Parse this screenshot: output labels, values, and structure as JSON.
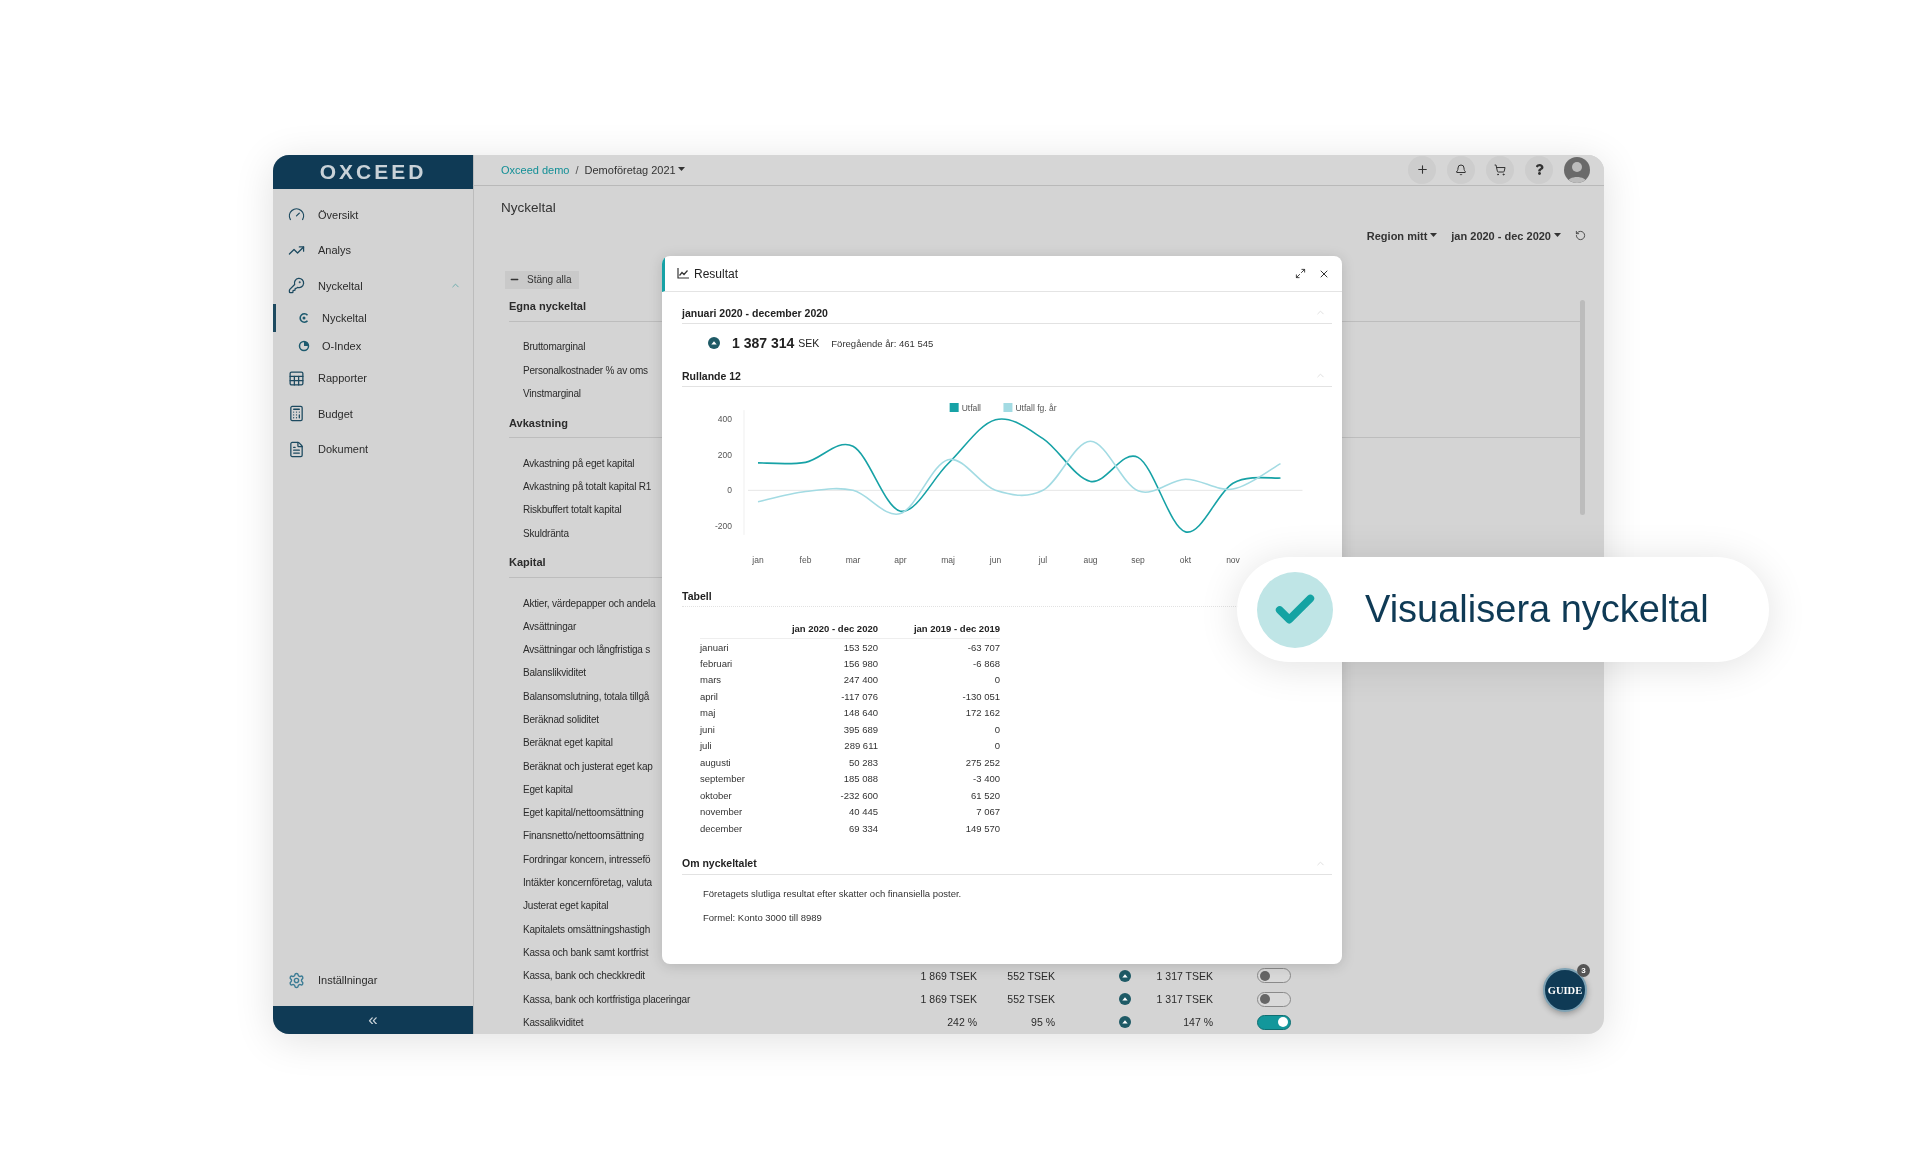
{
  "sidebar": {
    "logo": "OXCEED",
    "items": [
      {
        "label": "Översikt",
        "selected": false
      },
      {
        "label": "Analys",
        "selected": false
      },
      {
        "label": "Nyckeltal",
        "selected": false,
        "expanded": true,
        "children": [
          {
            "label": "Nyckeltal",
            "selected": true
          },
          {
            "label": "O-Index",
            "selected": false
          }
        ]
      },
      {
        "label": "Rapporter",
        "selected": false
      },
      {
        "label": "Budget",
        "selected": false
      },
      {
        "label": "Dokument",
        "selected": false
      }
    ],
    "settings": "Inställningar",
    "collapse": "«"
  },
  "topbar": {
    "breadcrumb": [
      {
        "kind": "link",
        "label": "Oxceed demo"
      },
      {
        "kind": "dropdown",
        "label": "Demoföretag 2021"
      }
    ],
    "separator": "/"
  },
  "page": {
    "title": "Nyckeltal",
    "filters": [
      {
        "label": "Region mitt"
      },
      {
        "label": "jan 2020 - dec 2020"
      }
    ],
    "collapse_all": "Stäng alla",
    "sections": [
      {
        "title": "Egna nyckeltal",
        "items": [
          {
            "label": "Bruttomarginal"
          },
          {
            "label": "Personalkostnader % av oms"
          },
          {
            "label": "Vinstmarginal"
          }
        ]
      },
      {
        "title": "Avkastning",
        "items": [
          {
            "label": "Avkastning på eget kapital"
          },
          {
            "label": "Avkastning på totalt kapital R1"
          },
          {
            "label": "Riskbuffert totalt kapital"
          },
          {
            "label": "Skuldränta"
          }
        ]
      },
      {
        "title": "Kapital",
        "items": [
          {
            "label": "Aktier, värdepapper och andela"
          },
          {
            "label": "Avsättningar"
          },
          {
            "label": "Avsättningar och långfristiga s"
          },
          {
            "label": "Balanslikviditet"
          },
          {
            "label": "Balansomslutning, totala tillgå"
          },
          {
            "label": "Beräknad soliditet"
          },
          {
            "label": "Beräknat eget kapital"
          },
          {
            "label": "Beräknat och justerat eget kap"
          },
          {
            "label": "Eget kapital"
          },
          {
            "label": "Eget kapital/nettoomsättning"
          },
          {
            "label": "Finansnetto/nettoomsättning"
          },
          {
            "label": "Fordringar koncern, intressefö"
          },
          {
            "label": "Intäkter koncernföretag, valuta"
          },
          {
            "label": "Justerat eget kapital"
          },
          {
            "label": "Kapitalets omsättningshastigh"
          },
          {
            "label": "Kassa och bank samt kortfrist"
          },
          {
            "label": "Kassa, bank och checkkredit",
            "values": {
              "current": "1 869 TSEK",
              "previous": "552 TSEK",
              "change": "1 317 TSEK",
              "on": false
            }
          },
          {
            "label": "Kassa, bank och kortfristiga placeringar",
            "values": {
              "current": "1 869 TSEK",
              "previous": "552 TSEK",
              "change": "1 317 TSEK",
              "on": false
            }
          },
          {
            "label": "Kassalikviditet",
            "values": {
              "current": "242 %",
              "previous": "95 %",
              "change": "147 %",
              "on": true
            }
          }
        ]
      }
    ]
  },
  "modal": {
    "title": "Resultat",
    "period": {
      "title": "januari 2020 - december 2020",
      "value": "1 387 314",
      "unit": "SEK",
      "previous": "Föregående år: 461 545"
    },
    "rolling": {
      "title": "Rullande 12",
      "chart_data": {
        "type": "line",
        "categories": [
          "jan",
          "feb",
          "mar",
          "apr",
          "maj",
          "jun",
          "jul",
          "aug",
          "sep",
          "okt",
          "nov",
          null
        ],
        "yticks": [
          -200,
          0,
          200,
          400
        ],
        "ylim": [
          -250,
          450
        ],
        "legend": "top",
        "series": [
          {
            "name": "Utfall",
            "color": "#17a2a6",
            "values": [
              154,
              157,
              247,
              -117,
              149,
              396,
              290,
              50,
              185,
              -233,
              40,
              69
            ]
          },
          {
            "name": "Utfall fg. år",
            "color": "#a3dbe3",
            "values": [
              -64,
              -7,
              0,
              -130,
              172,
              0,
              0,
              275,
              -3,
              62,
              7,
              150
            ]
          }
        ]
      }
    },
    "table": {
      "title": "Tabell",
      "columns": [
        "jan 2020 - dec 2020",
        "jan 2019 - dec 2019"
      ],
      "rows": [
        {
          "month": "januari",
          "values": [
            "153 520",
            "-63 707"
          ]
        },
        {
          "month": "februari",
          "values": [
            "156 980",
            "-6 868"
          ]
        },
        {
          "month": "mars",
          "values": [
            "247 400",
            "0"
          ]
        },
        {
          "month": "april",
          "values": [
            "-117 076",
            "-130 051"
          ]
        },
        {
          "month": "maj",
          "values": [
            "148 640",
            "172 162"
          ]
        },
        {
          "month": "juni",
          "values": [
            "395 689",
            "0"
          ]
        },
        {
          "month": "juli",
          "values": [
            "289 611",
            "0"
          ]
        },
        {
          "month": "augusti",
          "values": [
            "50 283",
            "275 252"
          ]
        },
        {
          "month": "september",
          "values": [
            "185 088",
            "-3 400"
          ]
        },
        {
          "month": "oktober",
          "values": [
            "-232 600",
            "61 520"
          ]
        },
        {
          "month": "november",
          "values": [
            "40 445",
            "7 067"
          ]
        },
        {
          "month": "december",
          "values": [
            "69 334",
            "149 570"
          ]
        }
      ]
    },
    "about": {
      "title": "Om nyckeltalet",
      "description": "Företagets slutliga resultat efter skatter och finansiella poster.",
      "formula": "Formel: Konto 3000 till 8989"
    }
  },
  "callout": {
    "text": "Visualisera nyckeltal"
  },
  "guide": {
    "label": "GUIDE",
    "badge": "3"
  }
}
